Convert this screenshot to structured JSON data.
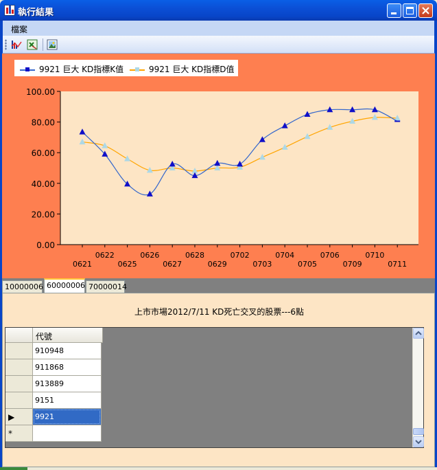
{
  "window": {
    "title": "執行結果"
  },
  "menu": {
    "items": [
      "檔案"
    ]
  },
  "toolbar": {
    "icons": [
      "chart-icon",
      "excel-export-icon",
      "picture-icon"
    ]
  },
  "chart_data": {
    "type": "line",
    "categories": [
      "0621",
      "0622",
      "0625",
      "0626",
      "0627",
      "0628",
      "0629",
      "0702",
      "0703",
      "0704",
      "0705",
      "0706",
      "0709",
      "0710",
      "0711"
    ],
    "series": [
      {
        "name": "9921 巨大 KD指標K值",
        "color": "#3366cc",
        "marker_color": "#1010c8",
        "marker": "triangle",
        "values": [
          73.5,
          59,
          39.5,
          33,
          52.5,
          45,
          53,
          52.5,
          68.5,
          77.5,
          85,
          88,
          88,
          88,
          80.5
        ]
      },
      {
        "name": "9921 巨大 KD指標D值",
        "color": "#ffa500",
        "marker_color": "#add8e6",
        "marker": "triangle",
        "values": [
          67,
          64.5,
          56,
          48.5,
          50,
          48,
          50,
          50.5,
          57,
          63.5,
          70.5,
          76.5,
          80.5,
          83,
          82.5
        ]
      }
    ],
    "ylim": [
      0,
      100
    ],
    "yticks": [
      "0.00",
      "20.00",
      "40.00",
      "60.00",
      "80.00",
      "100.00"
    ],
    "xlabel": "",
    "ylabel": "",
    "legend": "top-left",
    "grid": false,
    "colors": {
      "panel_background": "#fe7f50",
      "plot_background": "#fde5c5"
    }
  },
  "tabs": [
    {
      "label": "10000006"
    },
    {
      "label": "60000006",
      "active": true
    },
    {
      "label": "70000014"
    }
  ],
  "result": {
    "caption": "上市市場2012/7/11 KD死亡交叉的股票---6點",
    "column_header": "代號",
    "rows": [
      {
        "code": "910948",
        "marker": ""
      },
      {
        "code": "911868",
        "marker": ""
      },
      {
        "code": "913889",
        "marker": ""
      },
      {
        "code": "9151",
        "marker": ""
      },
      {
        "code": "9921",
        "marker": "▶",
        "selected": true
      },
      {
        "code": "",
        "marker": "*"
      }
    ]
  }
}
